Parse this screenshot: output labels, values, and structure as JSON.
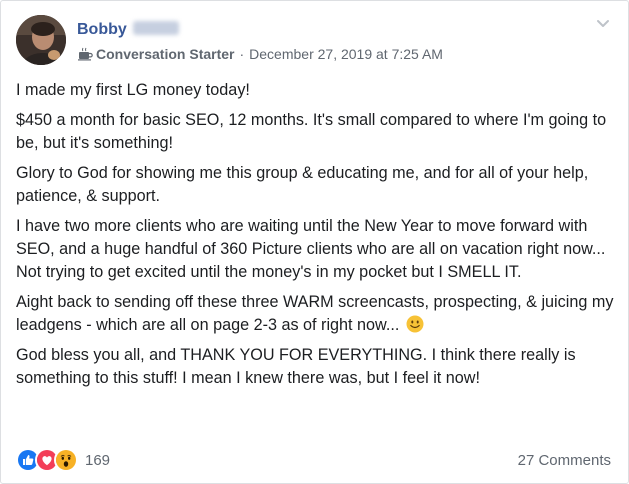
{
  "post": {
    "author_name": "Bobby",
    "badge": "Conversation Starter",
    "separator": "·",
    "timestamp": "December 27, 2019 at 7:25 AM",
    "paragraphs": [
      "I made my first LG money today!",
      "$450 a month for basic SEO, 12 months. It's small compared to where I'm going to be, but it's something!",
      "Glory to God for showing me this group & educating me, and for all of your help, patience, & support.",
      "I have two more clients who are waiting until the New Year to move forward with SEO, and a huge handful of 360 Picture clients who are all on vacation right now... Not trying to get excited until the money's in my pocket but I SMELL IT.",
      "Aight back to sending off these three WARM screencasts, prospecting, & juicing my leadgens - which are all on page 2-3 as of right now...",
      "God bless you all, and THANK YOU FOR EVERYTHING. I think there really is something to this stuff! I mean I knew there was, but I feel it now!"
    ],
    "emoji_icon": "smiling-face-icon",
    "reactions": {
      "icons": [
        "like-icon",
        "love-icon",
        "wow-icon"
      ],
      "count": "169"
    },
    "comments_label": "27 Comments"
  },
  "colors": {
    "author": "#385898",
    "meta": "#606770",
    "text": "#1c1e21",
    "like": "#1877f2",
    "love": "#f33e58",
    "wow": "#f7b125"
  }
}
